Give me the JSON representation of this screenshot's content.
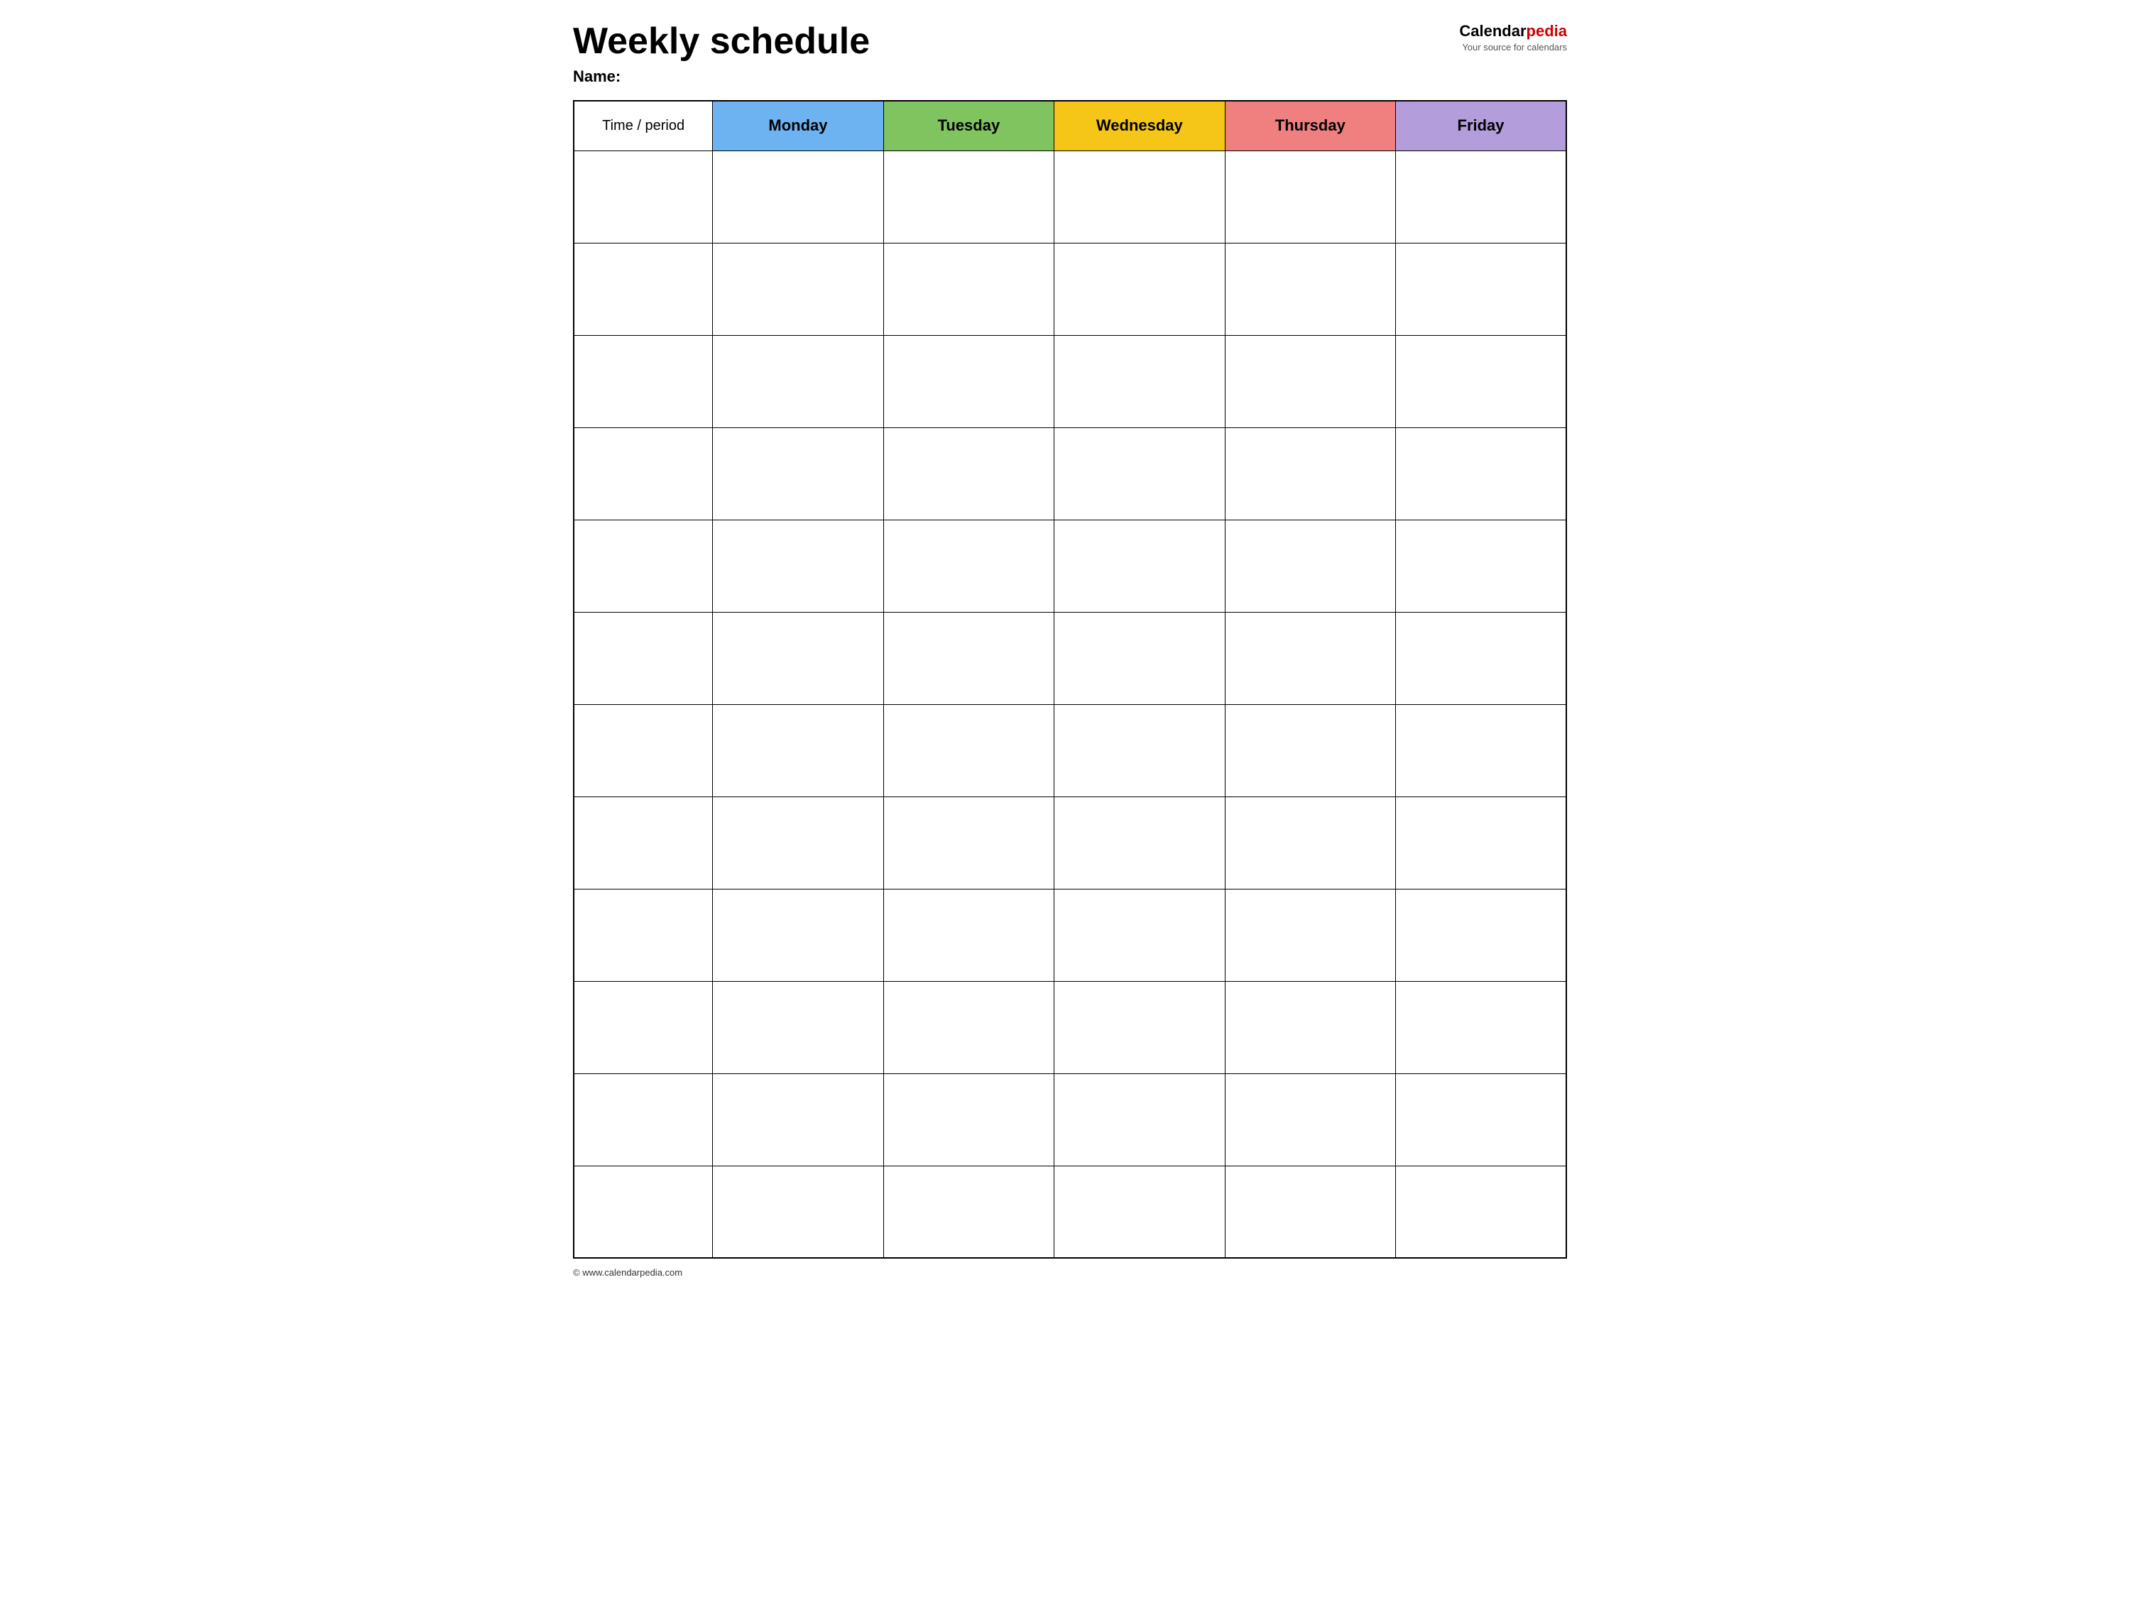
{
  "header": {
    "title": "Weekly schedule",
    "name_label": "Name:",
    "logo_text_black": "Calendar",
    "logo_text_red": "pedia",
    "logo_tagline": "Your source for calendars"
  },
  "table": {
    "columns": [
      {
        "id": "time",
        "label": "Time / period",
        "color": "#ffffff",
        "class": "time-header"
      },
      {
        "id": "monday",
        "label": "Monday",
        "color": "#6db3f2",
        "class": "monday-header"
      },
      {
        "id": "tuesday",
        "label": "Tuesday",
        "color": "#7fc45e",
        "class": "tuesday-header"
      },
      {
        "id": "wednesday",
        "label": "Wednesday",
        "color": "#f5c518",
        "class": "wednesday-header"
      },
      {
        "id": "thursday",
        "label": "Thursday",
        "color": "#f08080",
        "class": "thursday-header"
      },
      {
        "id": "friday",
        "label": "Friday",
        "color": "#b39ddb",
        "class": "friday-header"
      }
    ],
    "row_count": 12
  },
  "footer": {
    "url": "© www.calendarpedia.com"
  }
}
